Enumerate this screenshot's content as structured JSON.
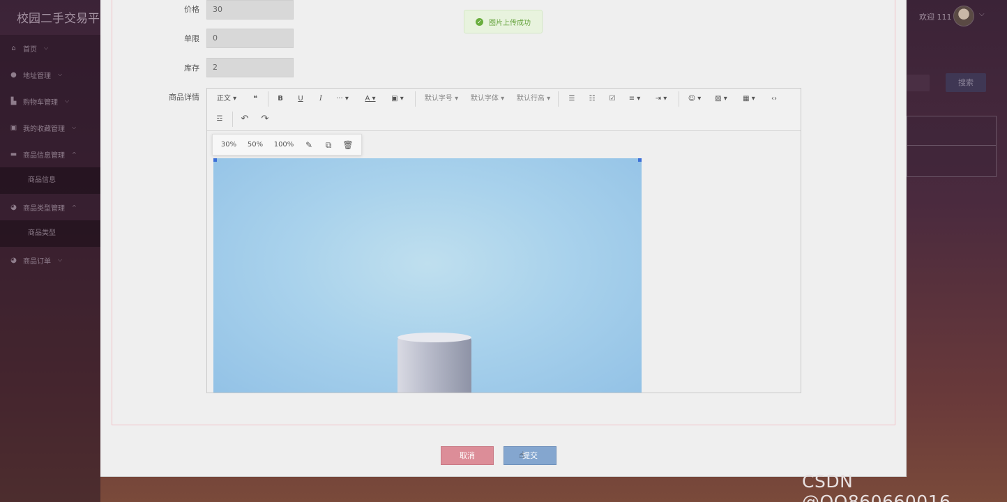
{
  "app": {
    "title": "校园二手交易平",
    "welcome": "欢迎 111",
    "watermark": "CSDN @QQ860660016"
  },
  "sidebar": {
    "items": [
      {
        "label": "首页",
        "icon": "home-icon"
      },
      {
        "label": "地址管理",
        "icon": "location-icon"
      },
      {
        "label": "购物车管理",
        "icon": "cart-icon"
      },
      {
        "label": "我的收藏管理",
        "icon": "favorite-icon"
      },
      {
        "label": "商品信息管理",
        "icon": "box-icon"
      },
      {
        "label": "商品信息"
      },
      {
        "label": "商品类型管理",
        "icon": "tag-icon"
      },
      {
        "label": "商品类型"
      },
      {
        "label": "商品订单",
        "icon": "order-icon"
      }
    ]
  },
  "background": {
    "search_label": "搜索"
  },
  "toast": {
    "message": "图片上传成功"
  },
  "form": {
    "price": {
      "label": "价格",
      "value": "30"
    },
    "limit": {
      "label": "单限",
      "value": "0"
    },
    "stock": {
      "label": "库存",
      "value": "2"
    },
    "detail_label": "商品详情"
  },
  "editor": {
    "toolbar": {
      "paragraph": "正文",
      "font_size": "默认字号",
      "font_family": "默认字体",
      "line_height": "默认行高"
    },
    "image_popup": {
      "w30": "30%",
      "w50": "50%",
      "w100": "100%"
    }
  },
  "buttons": {
    "cancel": "取消",
    "submit": "提交"
  }
}
